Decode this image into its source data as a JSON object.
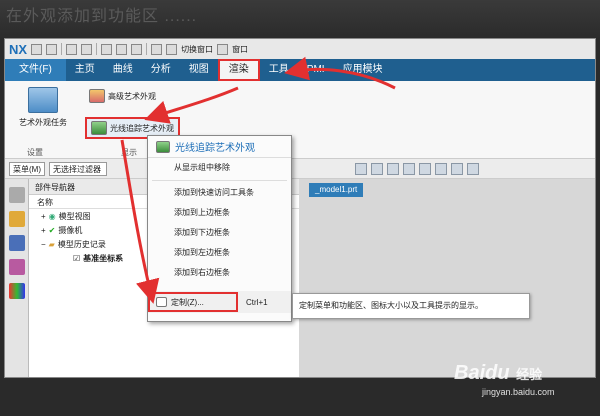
{
  "page": {
    "faded_title": "在外观添加到功能区 ......"
  },
  "qat": {
    "logo": "NX",
    "switch_window": "切换窗口",
    "window": "窗口"
  },
  "tabs": [
    {
      "label": "文件(F)"
    },
    {
      "label": "主页"
    },
    {
      "label": "曲线"
    },
    {
      "label": "分析"
    },
    {
      "label": "视图"
    },
    {
      "label": "渲染"
    },
    {
      "label": "工具"
    },
    {
      "label": "PMI"
    },
    {
      "label": "应用模块"
    }
  ],
  "ribbon": {
    "big_button": "艺术外观任务",
    "adv_art": "高级艺术外观",
    "raytrace": "光线追踪艺术外观",
    "group_settings": "设置",
    "group_display": "显示"
  },
  "toolbar2": {
    "menu": "菜单(M)",
    "filter": "无选择过滤器"
  },
  "nav": {
    "title": "部件导航器",
    "col_name": "名称",
    "items": [
      "模型视图",
      "摄像机",
      "模型历史记录",
      "基准坐标系"
    ]
  },
  "viewport": {
    "tab": "_model1.prt"
  },
  "context_menu": {
    "header": "光线追踪艺术外观",
    "items": [
      "从显示组中移除",
      "添加到快速访问工具条",
      "添加到上边框条",
      "添加到下边框条",
      "添加到左边框条",
      "添加到右边框条"
    ],
    "customize": "定制(Z)...",
    "shortcut": "Ctrl+1"
  },
  "tooltip": {
    "text": "定制菜单和功能区、图标大小以及工具提示的显示。"
  },
  "watermark": {
    "logo": "Baidu",
    "text": "经验",
    "url": "jingyan.baidu.com"
  },
  "colors": {
    "accent_red": "#e23030",
    "tab_blue": "#1f5f8f"
  }
}
